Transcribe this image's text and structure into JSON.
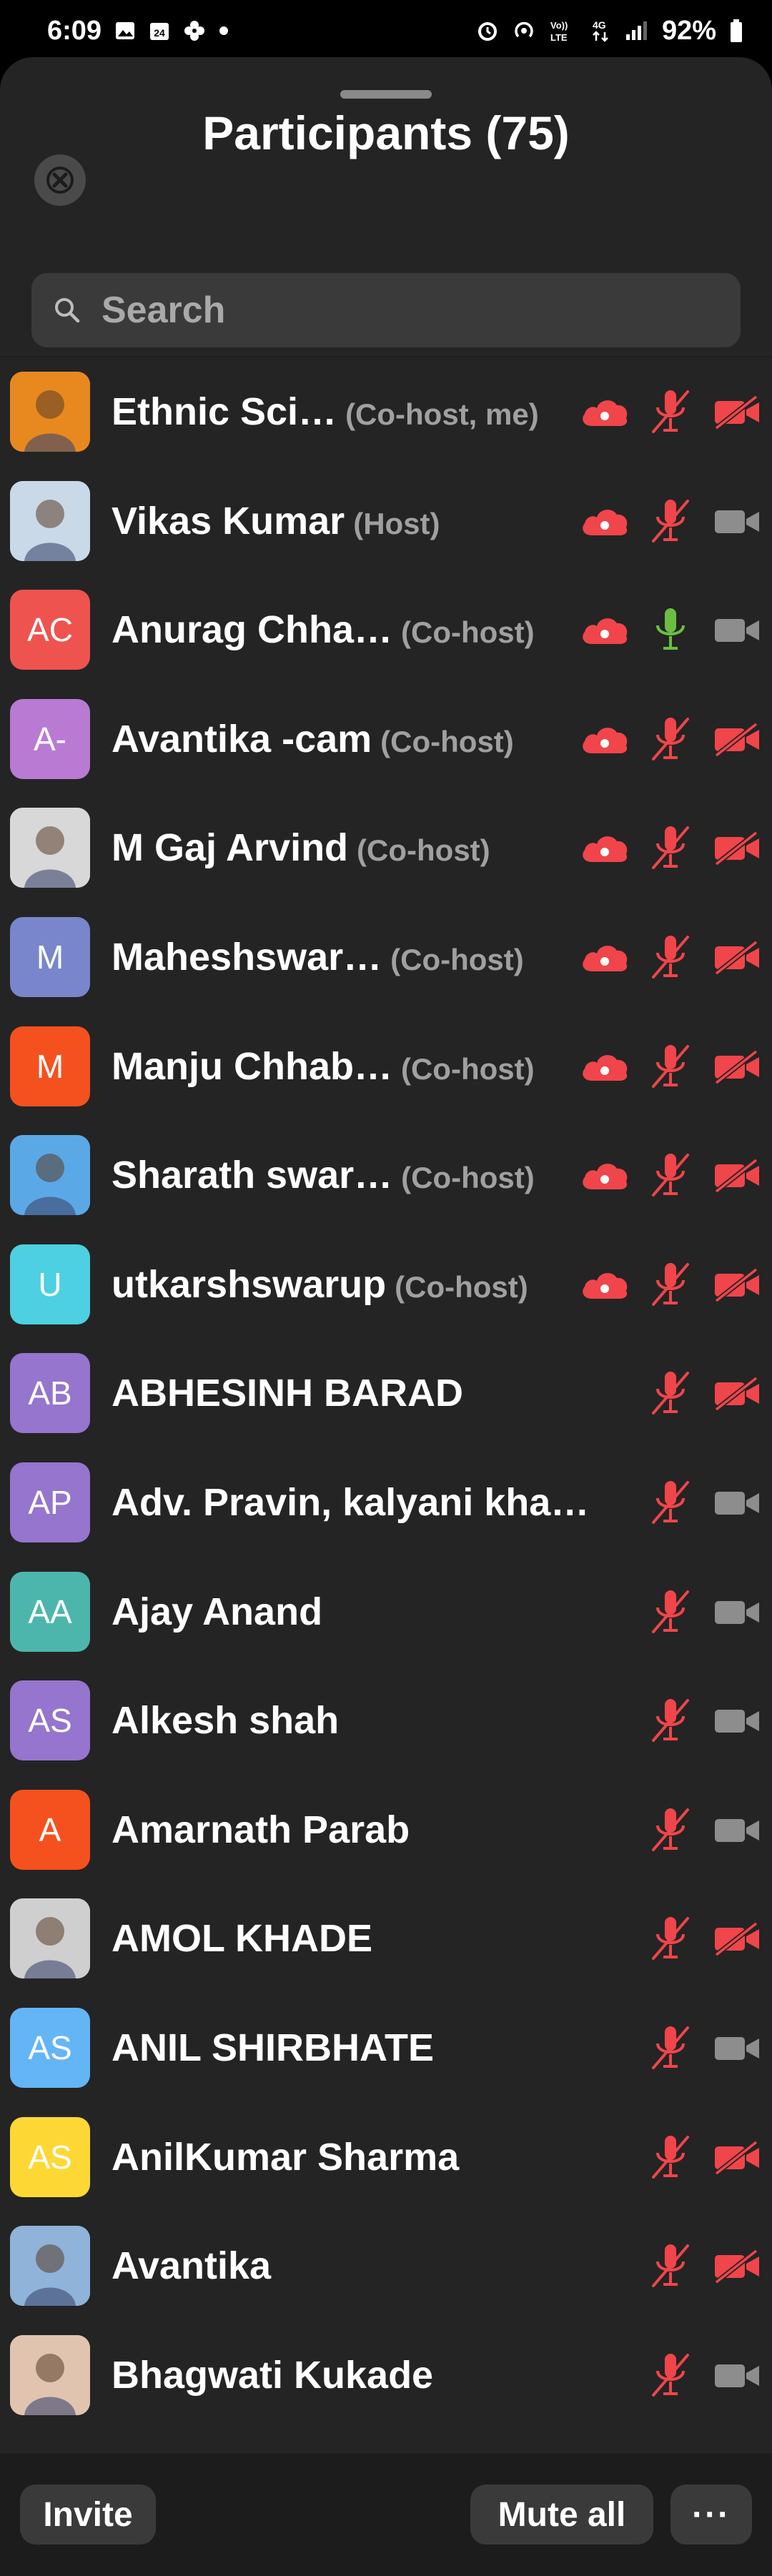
{
  "status_bar": {
    "time": "6:09",
    "battery": "92%"
  },
  "header": {
    "title": "Participants (75)"
  },
  "search": {
    "placeholder": "Search"
  },
  "participants": [
    {
      "name": "Ethnic Sci…",
      "role": "(Co-host, me)",
      "avatar_text": "",
      "avatar_color": "#e8891f",
      "cloud": true,
      "mic": "muted",
      "video": "off"
    },
    {
      "name": "Vikas Kumar",
      "role": "(Host)",
      "avatar_text": "",
      "avatar_color": "#c9d9e8",
      "cloud": true,
      "mic": "muted",
      "video": "on"
    },
    {
      "name": "Anurag Chha…",
      "role": "(Co-host)",
      "avatar_text": "AC",
      "avatar_color": "#ef5350",
      "cloud": true,
      "mic": "active",
      "video": "on"
    },
    {
      "name": "Avantika -cam",
      "role": "(Co-host)",
      "avatar_text": "A-",
      "avatar_color": "#b97ad3",
      "cloud": true,
      "mic": "muted",
      "video": "off"
    },
    {
      "name": "M Gaj Arvind",
      "role": "(Co-host)",
      "avatar_text": "",
      "avatar_color": "#d8d8d8",
      "cloud": true,
      "mic": "muted",
      "video": "off"
    },
    {
      "name": "Maheshswar…",
      "role": "(Co-host)",
      "avatar_text": "M",
      "avatar_color": "#7986cb",
      "cloud": true,
      "mic": "muted",
      "video": "off"
    },
    {
      "name": "Manju Chhab…",
      "role": "(Co-host)",
      "avatar_text": "M",
      "avatar_color": "#f4511e",
      "cloud": true,
      "mic": "muted",
      "video": "off"
    },
    {
      "name": "Sharath swar…",
      "role": "(Co-host)",
      "avatar_text": "",
      "avatar_color": "#5aa9e6",
      "cloud": true,
      "mic": "muted",
      "video": "off"
    },
    {
      "name": "utkarshswarup",
      "role": "(Co-host)",
      "avatar_text": "U",
      "avatar_color": "#4dd0e1",
      "cloud": true,
      "mic": "muted",
      "video": "off"
    },
    {
      "name": "ABHESINH BARAD",
      "role": "",
      "avatar_text": "AB",
      "avatar_color": "#9575cd",
      "cloud": false,
      "mic": "muted",
      "video": "off"
    },
    {
      "name": "Adv. Pravin, kalyani kha…",
      "role": "",
      "avatar_text": "AP",
      "avatar_color": "#9575cd",
      "cloud": false,
      "mic": "muted",
      "video": "on"
    },
    {
      "name": "Ajay Anand",
      "role": "",
      "avatar_text": "AA",
      "avatar_color": "#4db6ac",
      "cloud": false,
      "mic": "muted",
      "video": "on"
    },
    {
      "name": "Alkesh shah",
      "role": "",
      "avatar_text": "AS",
      "avatar_color": "#9575cd",
      "cloud": false,
      "mic": "muted",
      "video": "on"
    },
    {
      "name": "Amarnath Parab",
      "role": "",
      "avatar_text": "A",
      "avatar_color": "#f4511e",
      "cloud": false,
      "mic": "muted",
      "video": "on"
    },
    {
      "name": "AMOL KHADE",
      "role": "",
      "avatar_text": "",
      "avatar_color": "#cfcfcf",
      "cloud": false,
      "mic": "muted",
      "video": "off"
    },
    {
      "name": "ANIL SHIRBHATE",
      "role": "",
      "avatar_text": "AS",
      "avatar_color": "#64b5f6",
      "cloud": false,
      "mic": "muted",
      "video": "on"
    },
    {
      "name": "AnilKumar Sharma",
      "role": "",
      "avatar_text": "AS",
      "avatar_color": "#fdd835",
      "cloud": false,
      "mic": "muted",
      "video": "off"
    },
    {
      "name": "Avantika",
      "role": "",
      "avatar_text": "",
      "avatar_color": "#8fb3d9",
      "cloud": false,
      "mic": "muted",
      "video": "off"
    },
    {
      "name": "Bhagwati Kukade",
      "role": "",
      "avatar_text": "",
      "avatar_color": "#e0c4b0",
      "cloud": false,
      "mic": "muted",
      "video": "on"
    }
  ],
  "footer": {
    "invite": "Invite",
    "mute_all": "Mute all",
    "more": "···"
  },
  "colors": {
    "muted_red": "#f0454b",
    "active_green": "#6abf40",
    "video_gray": "#8d8d8d"
  }
}
